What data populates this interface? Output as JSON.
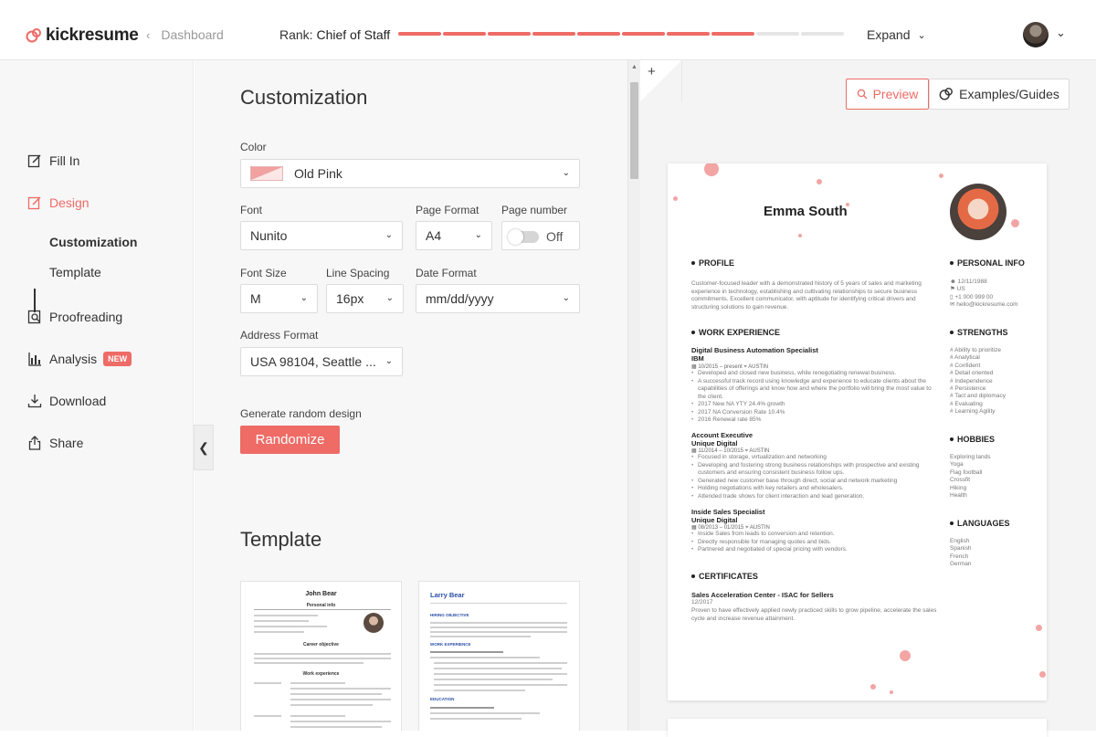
{
  "header": {
    "logo": "kickresume",
    "back_label": "Dashboard",
    "rank_label": "Rank:",
    "rank_value": "Chief of Staff",
    "rank_progress": 0.8,
    "expand_label": "Expand"
  },
  "sidebar": {
    "items": [
      {
        "label": "Fill In"
      },
      {
        "label": "Design"
      },
      {
        "label": "Customization"
      },
      {
        "label": "Template"
      },
      {
        "label": "Proofreading"
      },
      {
        "label": "Analysis",
        "badge": "NEW"
      },
      {
        "label": "Download"
      },
      {
        "label": "Share"
      }
    ]
  },
  "customization": {
    "title": "Customization",
    "color_label": "Color",
    "color_value": "Old Pink",
    "font_label": "Font",
    "font_value": "Nunito",
    "page_format_label": "Page Format",
    "page_format_value": "A4",
    "page_number_label": "Page number",
    "page_number_value": "Off",
    "font_size_label": "Font Size",
    "font_size_value": "M",
    "line_spacing_label": "Line Spacing",
    "line_spacing_value": "16px",
    "date_format_label": "Date Format",
    "date_format_value": "mm/dd/yyyy",
    "address_format_label": "Address Format",
    "address_format_value": "USA 98104, Seattle ...",
    "random_label": "Generate random design",
    "random_button": "Randomize"
  },
  "template": {
    "title": "Template",
    "cards": [
      {
        "name": "John Bear",
        "section1": "Personal info",
        "section2": "Career objective",
        "section3": "Work experience"
      },
      {
        "name": "Larry Bear",
        "section1": "HIRING OBJECTIVE",
        "section2": "WORK EXPERIENCE",
        "section3": "EDUCATION"
      }
    ]
  },
  "preview_toolbar": {
    "plus": "+",
    "preview_label": "Preview",
    "examples_label": "Examples/Guides"
  },
  "resume": {
    "name": "Emma South",
    "accent": "#ee6b66",
    "profile_heading": "PROFILE",
    "profile_text": "Customer-focused leader with a demonstrated history of 5 years of sales and marketing experience in technology, establishing and cultivating relationships to secure business commitments. Excellent communicator, with aptitude for identifying critical drivers and structuring solutions to gain revenue.",
    "work_heading": "WORK EXPERIENCE",
    "jobs": [
      {
        "title": "Digital Business Automation Specialist",
        "company": "IBM",
        "dates": "10/2015 – present",
        "location": "AUSTIN",
        "bullets": [
          "Developed and closed new business, while renegotiating renewal business.",
          "A successful track record using knowledge and experience  to educate clients about the capabilities of offerings and know how and where the portfolio will bring the most value to the client.",
          "2017 New NA YTY 24.4% growth",
          "2017 NA Conversion Rate 10.4%",
          "2016 Renewal rate 85%"
        ]
      },
      {
        "title": "Account Executive",
        "company": "Unique Digital",
        "dates": "11/2014 – 10/2015",
        "location": "AUSTIN",
        "bullets": [
          "Focused in storage, virtualization and networking",
          "Developing and fostering strong business relationships with prospective and existing customers and ensuring consistent business follow ups.",
          "Generated new customer base through direct, social and network marketing",
          "Holding negotiations with key retailers and wholesalers.",
          "Attended trade shows for client interaction and lead generation."
        ]
      },
      {
        "title": "Inside Sales Specialist",
        "company": "Unique Digital",
        "dates": "08/2013 – 01/2015",
        "location": "AUSTIN",
        "bullets": [
          "Inside Sales from leads to conversion and retention.",
          "Directly responsible for managing quotes and bids.",
          "Partnered and negotiated of special pricing with vendors."
        ]
      }
    ],
    "cert_heading": "CERTIFICATES",
    "cert_title": "Sales Acceleration Center - ISAC for Sellers",
    "cert_date": "12/2017",
    "cert_text": "Proven to have effectively applied newly practiced skills to grow pipeline, accelerate the sales cycle and increase revenue attainment.",
    "personal_heading": "PERSONAL INFO",
    "personal": [
      "12/11/1988",
      "US",
      "+1 000 999 00",
      "hello@kickresume.com"
    ],
    "strengths_heading": "STRENGTHS",
    "strengths": [
      "# Ability to prioritize",
      "# Analytical",
      "# Confident",
      "# Detail oriented",
      "# Independence",
      "# Persistence",
      "# Tact and diplomacy",
      "# Evaluating",
      "# Learning Agility"
    ],
    "hobbies_heading": "HOBBIES",
    "hobbies": [
      "Exploring lands",
      "Yoga",
      "Flag football",
      "Crossfit",
      "Hiking",
      "Health"
    ],
    "languages_heading": "LANGUAGES",
    "languages": [
      "English",
      "Spanish",
      "French",
      "German"
    ]
  }
}
